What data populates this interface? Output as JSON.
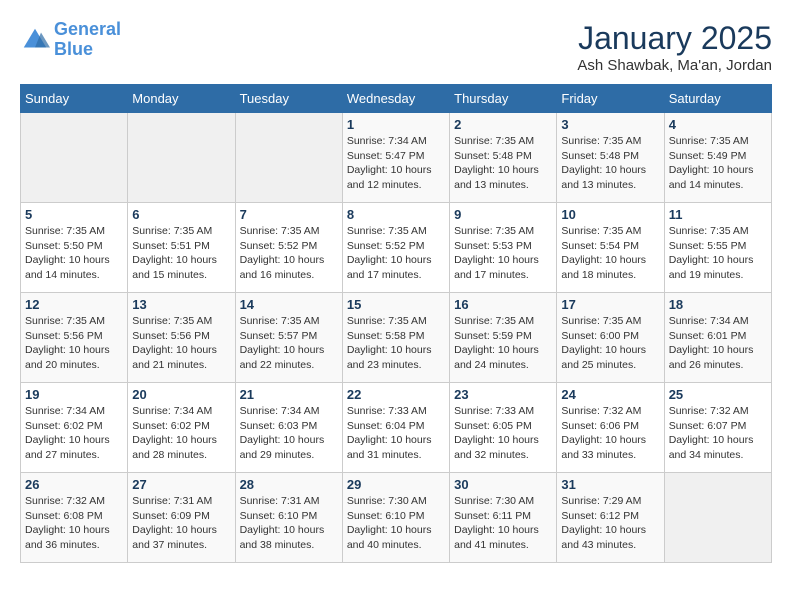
{
  "header": {
    "logo_line1": "General",
    "logo_line2": "Blue",
    "month": "January 2025",
    "location": "Ash Shawbak, Ma'an, Jordan"
  },
  "weekdays": [
    "Sunday",
    "Monday",
    "Tuesday",
    "Wednesday",
    "Thursday",
    "Friday",
    "Saturday"
  ],
  "weeks": [
    [
      {
        "day": "",
        "text": ""
      },
      {
        "day": "",
        "text": ""
      },
      {
        "day": "",
        "text": ""
      },
      {
        "day": "1",
        "text": "Sunrise: 7:34 AM\nSunset: 5:47 PM\nDaylight: 10 hours\nand 12 minutes."
      },
      {
        "day": "2",
        "text": "Sunrise: 7:35 AM\nSunset: 5:48 PM\nDaylight: 10 hours\nand 13 minutes."
      },
      {
        "day": "3",
        "text": "Sunrise: 7:35 AM\nSunset: 5:48 PM\nDaylight: 10 hours\nand 13 minutes."
      },
      {
        "day": "4",
        "text": "Sunrise: 7:35 AM\nSunset: 5:49 PM\nDaylight: 10 hours\nand 14 minutes."
      }
    ],
    [
      {
        "day": "5",
        "text": "Sunrise: 7:35 AM\nSunset: 5:50 PM\nDaylight: 10 hours\nand 14 minutes."
      },
      {
        "day": "6",
        "text": "Sunrise: 7:35 AM\nSunset: 5:51 PM\nDaylight: 10 hours\nand 15 minutes."
      },
      {
        "day": "7",
        "text": "Sunrise: 7:35 AM\nSunset: 5:52 PM\nDaylight: 10 hours\nand 16 minutes."
      },
      {
        "day": "8",
        "text": "Sunrise: 7:35 AM\nSunset: 5:52 PM\nDaylight: 10 hours\nand 17 minutes."
      },
      {
        "day": "9",
        "text": "Sunrise: 7:35 AM\nSunset: 5:53 PM\nDaylight: 10 hours\nand 17 minutes."
      },
      {
        "day": "10",
        "text": "Sunrise: 7:35 AM\nSunset: 5:54 PM\nDaylight: 10 hours\nand 18 minutes."
      },
      {
        "day": "11",
        "text": "Sunrise: 7:35 AM\nSunset: 5:55 PM\nDaylight: 10 hours\nand 19 minutes."
      }
    ],
    [
      {
        "day": "12",
        "text": "Sunrise: 7:35 AM\nSunset: 5:56 PM\nDaylight: 10 hours\nand 20 minutes."
      },
      {
        "day": "13",
        "text": "Sunrise: 7:35 AM\nSunset: 5:56 PM\nDaylight: 10 hours\nand 21 minutes."
      },
      {
        "day": "14",
        "text": "Sunrise: 7:35 AM\nSunset: 5:57 PM\nDaylight: 10 hours\nand 22 minutes."
      },
      {
        "day": "15",
        "text": "Sunrise: 7:35 AM\nSunset: 5:58 PM\nDaylight: 10 hours\nand 23 minutes."
      },
      {
        "day": "16",
        "text": "Sunrise: 7:35 AM\nSunset: 5:59 PM\nDaylight: 10 hours\nand 24 minutes."
      },
      {
        "day": "17",
        "text": "Sunrise: 7:35 AM\nSunset: 6:00 PM\nDaylight: 10 hours\nand 25 minutes."
      },
      {
        "day": "18",
        "text": "Sunrise: 7:34 AM\nSunset: 6:01 PM\nDaylight: 10 hours\nand 26 minutes."
      }
    ],
    [
      {
        "day": "19",
        "text": "Sunrise: 7:34 AM\nSunset: 6:02 PM\nDaylight: 10 hours\nand 27 minutes."
      },
      {
        "day": "20",
        "text": "Sunrise: 7:34 AM\nSunset: 6:02 PM\nDaylight: 10 hours\nand 28 minutes."
      },
      {
        "day": "21",
        "text": "Sunrise: 7:34 AM\nSunset: 6:03 PM\nDaylight: 10 hours\nand 29 minutes."
      },
      {
        "day": "22",
        "text": "Sunrise: 7:33 AM\nSunset: 6:04 PM\nDaylight: 10 hours\nand 31 minutes."
      },
      {
        "day": "23",
        "text": "Sunrise: 7:33 AM\nSunset: 6:05 PM\nDaylight: 10 hours\nand 32 minutes."
      },
      {
        "day": "24",
        "text": "Sunrise: 7:32 AM\nSunset: 6:06 PM\nDaylight: 10 hours\nand 33 minutes."
      },
      {
        "day": "25",
        "text": "Sunrise: 7:32 AM\nSunset: 6:07 PM\nDaylight: 10 hours\nand 34 minutes."
      }
    ],
    [
      {
        "day": "26",
        "text": "Sunrise: 7:32 AM\nSunset: 6:08 PM\nDaylight: 10 hours\nand 36 minutes."
      },
      {
        "day": "27",
        "text": "Sunrise: 7:31 AM\nSunset: 6:09 PM\nDaylight: 10 hours\nand 37 minutes."
      },
      {
        "day": "28",
        "text": "Sunrise: 7:31 AM\nSunset: 6:10 PM\nDaylight: 10 hours\nand 38 minutes."
      },
      {
        "day": "29",
        "text": "Sunrise: 7:30 AM\nSunset: 6:10 PM\nDaylight: 10 hours\nand 40 minutes."
      },
      {
        "day": "30",
        "text": "Sunrise: 7:30 AM\nSunset: 6:11 PM\nDaylight: 10 hours\nand 41 minutes."
      },
      {
        "day": "31",
        "text": "Sunrise: 7:29 AM\nSunset: 6:12 PM\nDaylight: 10 hours\nand 43 minutes."
      },
      {
        "day": "",
        "text": ""
      }
    ]
  ]
}
